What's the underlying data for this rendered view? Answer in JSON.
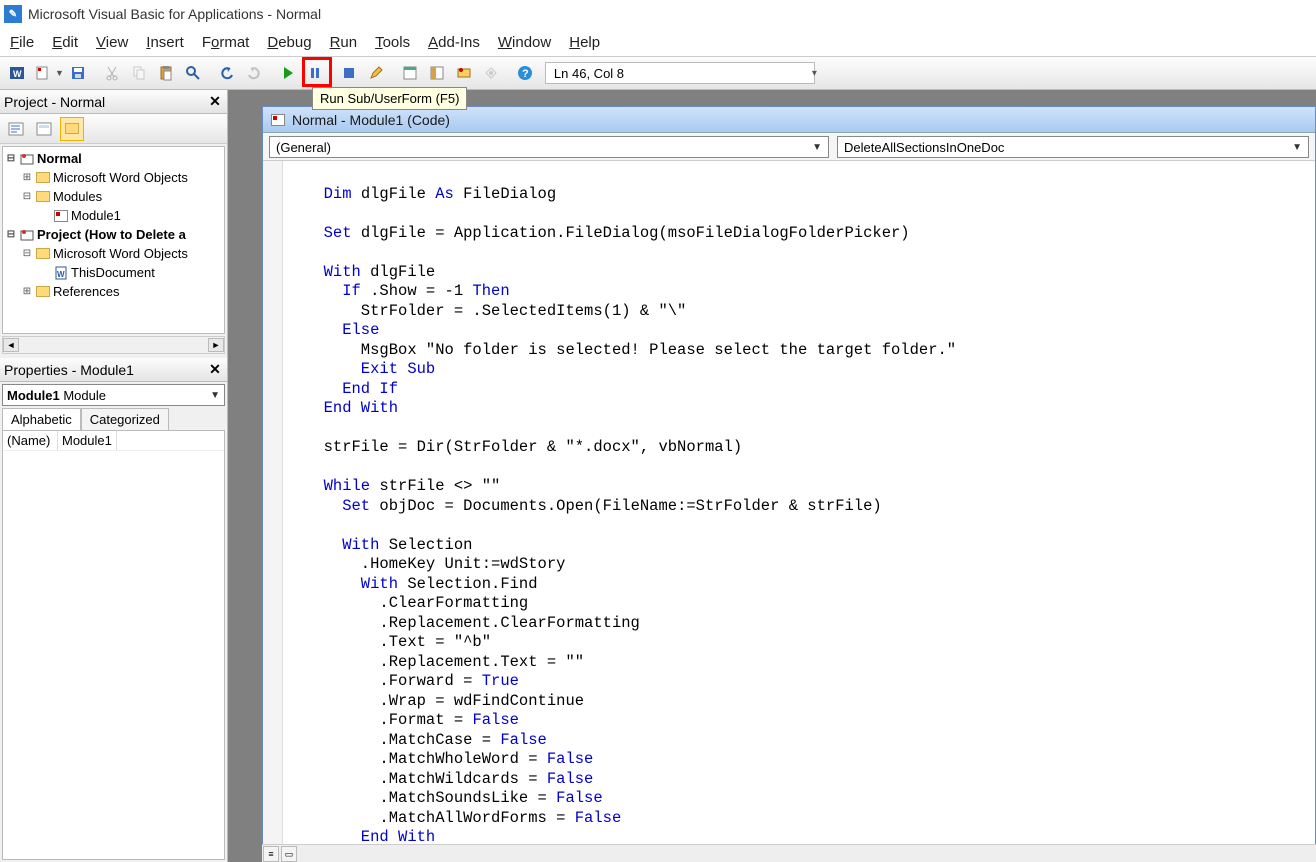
{
  "title": "Microsoft Visual Basic for Applications - Normal",
  "menu": {
    "file": "File",
    "edit": "Edit",
    "view": "View",
    "insert": "Insert",
    "format": "Format",
    "debug": "Debug",
    "run": "Run",
    "tools": "Tools",
    "addins": "Add-Ins",
    "window": "Window",
    "help": "Help"
  },
  "tooltip": "Run Sub/UserForm (F5)",
  "status": "Ln 46, Col 8",
  "project_pane_title": "Project - Normal",
  "properties_pane_title": "Properties - Module1",
  "tree": {
    "normal": "Normal",
    "mwo1": "Microsoft Word Objects",
    "modules": "Modules",
    "module1": "Module1",
    "project2": "Project (How to Delete a",
    "mwo2": "Microsoft Word Objects",
    "thisdoc": "ThisDocument",
    "refs": "References"
  },
  "props": {
    "combo_bold": "Module1",
    "combo_rest": " Module",
    "tab_alpha": "Alphabetic",
    "tab_cat": "Categorized",
    "name_key": "(Name)",
    "name_val": "Module1"
  },
  "codewin": {
    "title": "Normal - Module1 (Code)",
    "dd_left": "(General)",
    "dd_right": "DeleteAllSectionsInOneDoc"
  },
  "code": {
    "l1a": "  Dim",
    "l1b": " dlgFile ",
    "l1c": "As",
    "l1d": " FileDialog",
    "l2": "",
    "l3a": "  Set",
    "l3b": " dlgFile = Application.FileDialog(msoFileDialogFolderPicker)",
    "l4": "",
    "l5a": "  With",
    "l5b": " dlgFile",
    "l6a": "    If",
    "l6b": " .Show = -1 ",
    "l6c": "Then",
    "l7": "      StrFolder = .SelectedItems(1) & \"\\\"",
    "l8": "    Else",
    "l9": "      MsgBox \"No folder is selected! Please select the target folder.\"",
    "l10": "      Exit Sub",
    "l11": "    End If",
    "l12": "  End With",
    "l13": "",
    "l14": "  strFile = Dir(StrFolder & \"*.docx\", vbNormal)",
    "l15": "",
    "l16a": "  While",
    "l16b": " strFile <> \"\"",
    "l17a": "    Set",
    "l17b": " objDoc = Documents.Open(FileName:=StrFolder & strFile)",
    "l18": "",
    "l19a": "    With",
    "l19b": " Selection",
    "l20": "      .HomeKey Unit:=wdStory",
    "l21a": "      With",
    "l21b": " Selection.Find",
    "l22": "        .ClearFormatting",
    "l23": "        .Replacement.ClearFormatting",
    "l24": "        .Text = \"^b\"",
    "l25": "        .Replacement.Text = \"\"",
    "l26a": "        .Forward = ",
    "l26b": "True",
    "l27": "        .Wrap = wdFindContinue",
    "l28a": "        .Format = ",
    "l28b": "False",
    "l29a": "        .MatchCase = ",
    "l29b": "False",
    "l30a": "        .MatchWholeWord = ",
    "l30b": "False",
    "l31a": "        .MatchWildcards = ",
    "l31b": "False",
    "l32a": "        .MatchSoundsLike = ",
    "l32b": "False",
    "l33a": "        .MatchAllWordForms = ",
    "l33b": "False",
    "l34": "      End With"
  }
}
